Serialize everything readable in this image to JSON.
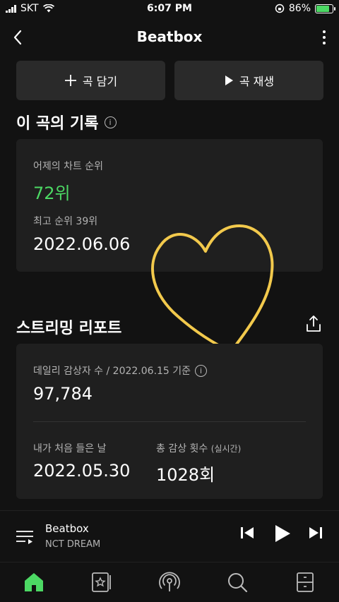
{
  "status_bar": {
    "carrier": "SKT",
    "time": "6:07 PM",
    "battery_percent": "86%",
    "battery_level": 0.86
  },
  "header": {
    "title": "Beatbox"
  },
  "actions": {
    "add_label": "곡 담기",
    "play_label": "곡 재생"
  },
  "history": {
    "section_title": "이 곡의 기록",
    "yesterday_label": "어제의 차트 순위",
    "yesterday_value": "72위",
    "peak_label": "최고 순위 39위",
    "peak_date": "2022.06.06"
  },
  "report": {
    "section_title": "스트리밍 리포트",
    "daily_label": "데일리 감상자 수 / 2022.06.15 기준",
    "daily_value": "97,784",
    "first_heard_label": "내가 처음 들은 날",
    "first_heard_value": "2022.05.30",
    "total_plays_label": "총 감상 횟수",
    "total_plays_sub": "(실시간)",
    "total_plays_value": "1028회"
  },
  "player": {
    "song": "Beatbox",
    "artist": "NCT DREAM"
  },
  "colors": {
    "accent": "#4cd964",
    "heart": "#f2c94c",
    "background": "#121212",
    "card": "#1f1f1f"
  },
  "nav_icons": [
    "home-icon",
    "library-icon",
    "podcast-icon",
    "search-icon",
    "storage-icon"
  ]
}
